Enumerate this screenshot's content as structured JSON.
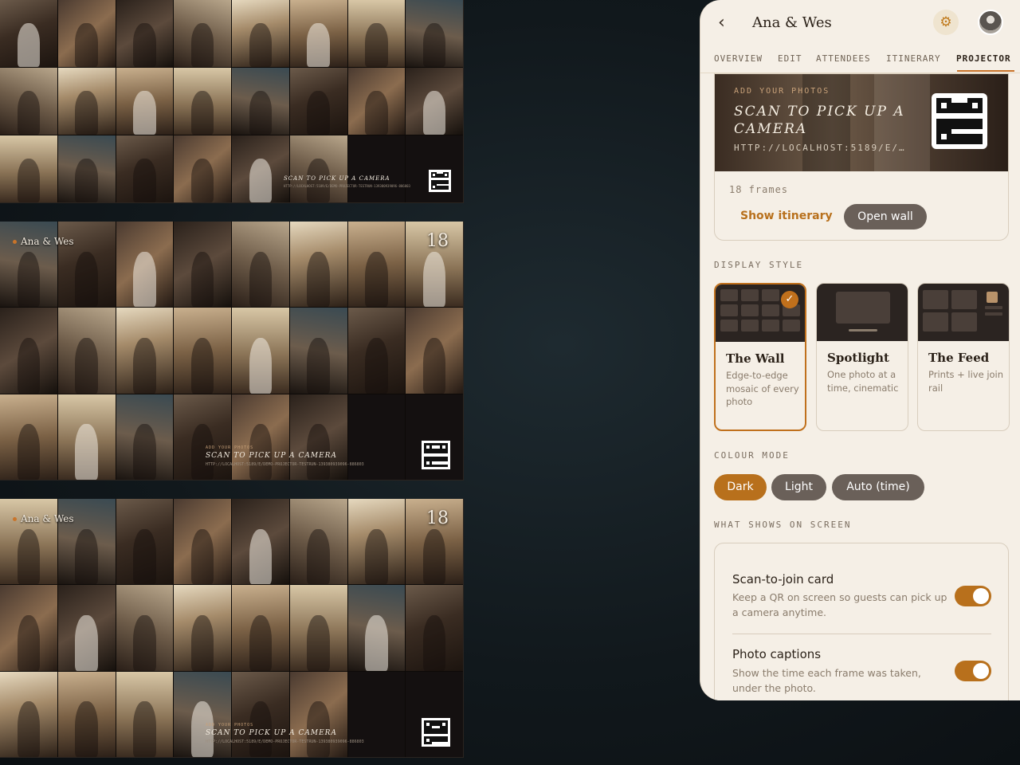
{
  "walls": [
    {
      "show_title": false,
      "event_title": "Ana & Wes",
      "photo_count": "",
      "cta_kicker": "",
      "cta_heading": "SCAN TO PICK UP A CAMERA",
      "cta_url": "HTTP://LOCALHOST:5189/E/DEMO-PROJECTOR-TESTRUN-139380939096-886803"
    },
    {
      "show_title": true,
      "event_title": "Ana & Wes",
      "photo_count": "18",
      "cta_kicker": "ADD YOUR PHOTOS",
      "cta_heading": "SCAN TO PICK UP A CAMERA",
      "cta_url": "HTTP://LOCALHOST:5189/E/DEMO-PROJECTOR-TESTRUN-139380939096-886803"
    },
    {
      "show_title": true,
      "event_title": "Ana & Wes",
      "photo_count": "18",
      "cta_kicker": "ADD YOUR PHOTOS",
      "cta_heading": "SCAN TO PICK UP A CAMERA",
      "cta_url": "HTTP://LOCALHOST:5189/E/DEMO-PROJECTOR-TESTRUN-139380939096-886803"
    }
  ],
  "app": {
    "back_icon": "chevron-left-icon",
    "title": "Ana & Wes",
    "settings_icon": "gear-icon",
    "tabs": [
      {
        "label": "OVERVIEW",
        "active": false
      },
      {
        "label": "EDIT",
        "active": false
      },
      {
        "label": "ATTENDEES",
        "active": false
      },
      {
        "label": "ITINERARY",
        "active": false
      },
      {
        "label": "PROJECTOR",
        "active": true
      }
    ],
    "accent": "#b8701c"
  },
  "qr_card": {
    "kicker": "ADD YOUR PHOTOS",
    "heading": "SCAN TO PICK UP A CAMERA",
    "url": "HTTP://LOCALHOST:5189/E/…",
    "frames": "18 frames",
    "show_itinerary": "Show itinerary",
    "open_wall": "Open wall"
  },
  "display_style": {
    "label": "DISPLAY STYLE",
    "options": [
      {
        "name": "The Wall",
        "desc": "Edge-to-edge mosaic of every photo",
        "selected": true
      },
      {
        "name": "Spotlight",
        "desc": "One photo at a time, cinematic",
        "selected": false
      },
      {
        "name": "The Feed",
        "desc": "Prints + live join rail",
        "selected": false
      }
    ]
  },
  "colour_mode": {
    "label": "COLOUR MODE",
    "options": [
      {
        "label": "Dark",
        "active": true
      },
      {
        "label": "Light",
        "active": false
      },
      {
        "label": "Auto (time)",
        "active": false
      }
    ]
  },
  "screen": {
    "label": "WHAT SHOWS ON SCREEN",
    "toggles": [
      {
        "title": "Scan-to-join card",
        "desc": "Keep a QR on screen so guests can pick up a camera anytime.",
        "on": true
      },
      {
        "title": "Photo captions",
        "desc": "Show the time each frame was taken, under the photo.",
        "on": true
      }
    ]
  }
}
